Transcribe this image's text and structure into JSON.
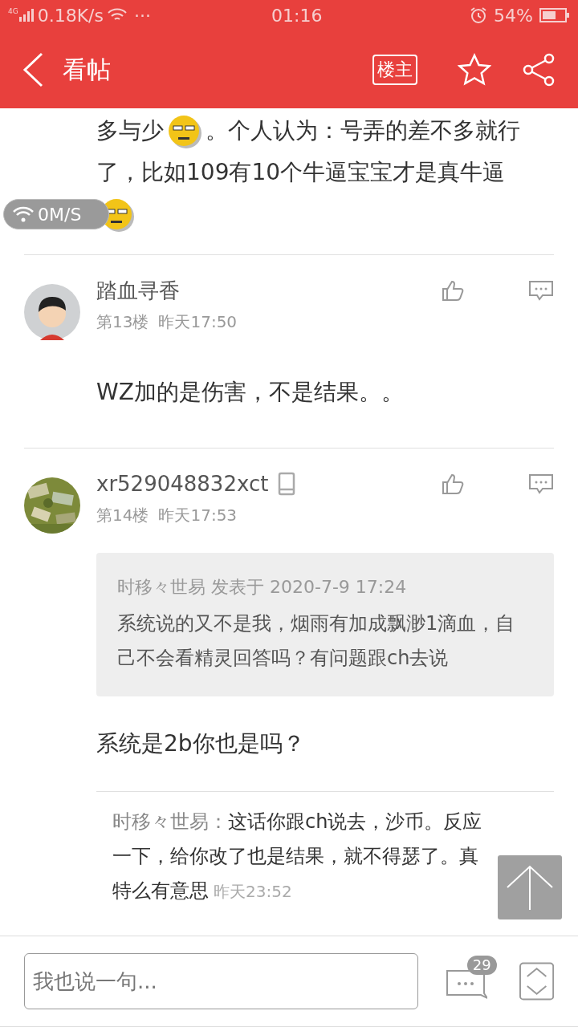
{
  "status_bar": {
    "network": "4G",
    "speed": "0.18K/s",
    "more": "···",
    "time": "01:16",
    "battery": "54%"
  },
  "nav": {
    "title": "看帖",
    "owner_label": "楼主"
  },
  "top_post": {
    "content": [
      {
        "kind": "text",
        "text": "多与少"
      },
      {
        "kind": "emoji"
      },
      {
        "kind": "text",
        "text": "。个人认为：号弄的差不多就行了，比如109有10个牛逼宝宝才是真牛逼"
      },
      {
        "kind": "emoji"
      }
    ]
  },
  "speed_overlay": "0M/S",
  "posts": [
    {
      "author": "踏血寻香",
      "mobile": false,
      "avatar": {
        "kind": "cartoon"
      },
      "floor": "第13楼",
      "time": "昨天17:50",
      "text": "WZ加的是伤害，不是结果。。"
    },
    {
      "author": "xr529048832xct",
      "mobile": true,
      "avatar": {
        "kind": "picture"
      },
      "floor": "第14楼",
      "time": "昨天17:53",
      "quote": {
        "header": "时移々世易 发表于 2020-7-9 17:24",
        "text": "系统说的又不是我，烟雨有加成飘渺1滴血，自己不会看精灵回答吗？有问题跟ch去说"
      },
      "text": "系统是2b你也是吗？",
      "replies": [
        {
          "author": "时移々世易：",
          "text": "这话你跟ch说去，沙币。反应一下，给你改了也是结果，就不得瑟了。真特么有意思",
          "time": "昨天23:52"
        }
      ]
    }
  ],
  "reply_bar": {
    "placeholder": "我也说一句...",
    "comment_count": "29"
  }
}
